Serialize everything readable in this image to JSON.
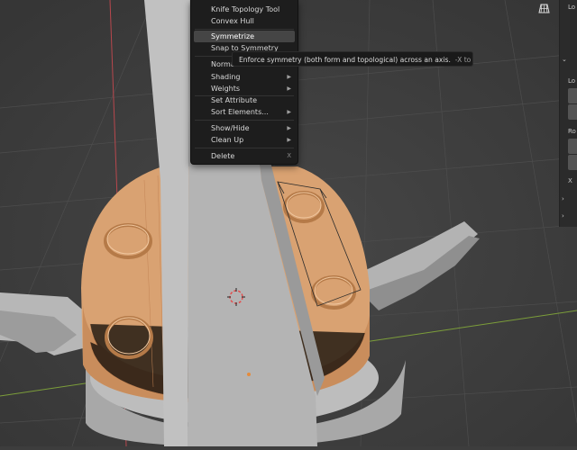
{
  "context_menu": {
    "items": [
      {
        "label": "Knife Topology Tool",
        "submenu": false,
        "highlighted": false
      },
      {
        "label": "Convex Hull",
        "submenu": false,
        "highlighted": false
      },
      {
        "label": "Symmetrize",
        "submenu": false,
        "highlighted": true
      },
      {
        "label": "Snap to Symmetry",
        "submenu": false,
        "highlighted": false
      },
      {
        "label": "Normals",
        "submenu": true,
        "highlighted": false
      },
      {
        "label": "Shading",
        "submenu": true,
        "highlighted": false
      },
      {
        "label": "Weights",
        "submenu": true,
        "highlighted": false
      },
      {
        "label": "Set Attribute",
        "submenu": false,
        "highlighted": false
      },
      {
        "label": "Sort Elements...",
        "submenu": true,
        "highlighted": false
      },
      {
        "label": "Show/Hide",
        "submenu": true,
        "highlighted": false
      },
      {
        "label": "Clean Up",
        "submenu": true,
        "highlighted": false
      },
      {
        "label": "Delete",
        "submenu": false,
        "highlighted": false,
        "shortcut": "X"
      }
    ]
  },
  "tooltip": {
    "text": "Enforce symmetry (both form and topological) across an axis.",
    "axis": "-X to +X"
  },
  "sidebar": {
    "labels": [
      "Lo",
      "Lo",
      "Ro",
      "X",
      "›",
      "›"
    ]
  },
  "colors": {
    "viewport_bg": "#3d3d3d",
    "menu_bg": "#1d1d1d",
    "menu_highlight": "#454545",
    "mesh_selected": "#d9a272",
    "mesh_gray": "#b9b9b9",
    "axis_red": "#b8474d",
    "axis_green": "#7c9e3a"
  },
  "icons": [
    "grid-view-icon",
    "submenu-arrow-icon",
    "3d-cursor-icon",
    "origin-dot-icon"
  ]
}
